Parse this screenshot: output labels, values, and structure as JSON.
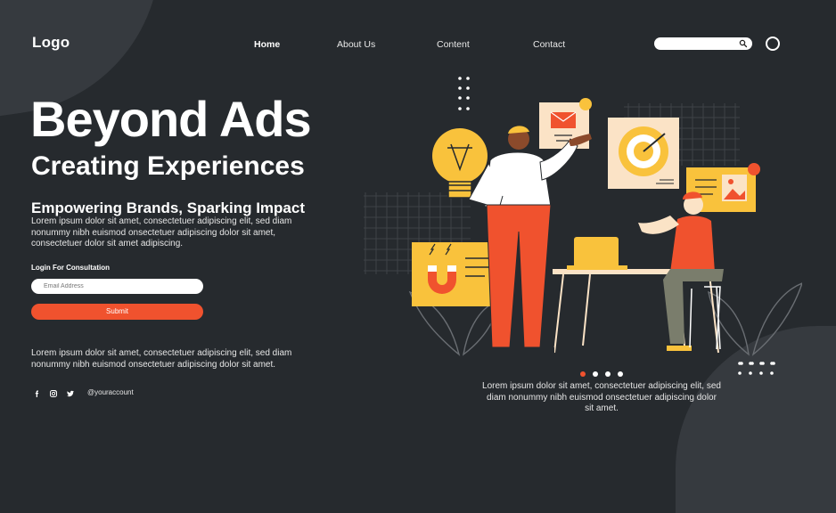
{
  "header": {
    "logo": "Logo",
    "nav": [
      {
        "label": "Home",
        "active": true
      },
      {
        "label": "About Us",
        "active": false
      },
      {
        "label": "Content",
        "active": false
      },
      {
        "label": "Contact",
        "active": false
      }
    ],
    "search_icon": "search-icon"
  },
  "hero": {
    "title": "Beyond Ads",
    "subtitle": "Creating Experiences",
    "tagline": "Empowering Brands, Sparking Impact",
    "description": "Lorem ipsum dolor sit amet, consectetuer adipiscing elit, sed diam nonummy nibh euismod onsectetuer adipiscing dolor sit amet, consectetuer dolor sit amet adipiscing."
  },
  "form": {
    "label": "Login For Consultation",
    "email_placeholder": "Email Address",
    "submit_label": "Submit"
  },
  "footer": {
    "text": "Lorem ipsum dolor sit amet, consectetuer adipiscing elit, sed diam nonummy nibh euismod onsectetuer adipiscing dolor sit amet.",
    "social_icons": [
      "facebook-icon",
      "instagram-icon",
      "twitter-icon"
    ],
    "handle": "@youraccount"
  },
  "carousel": {
    "caption": "Lorem ipsum dolor sit amet, consectetuer adipiscing elit, sed diam nonummy nibh euismod onsectetuer adipiscing dolor sit amet.",
    "slide_count": 4,
    "active_index": 0
  },
  "colors": {
    "background": "#262A2E",
    "accent": "#F0522E",
    "yellow": "#F9C23C",
    "cream": "#FBE3C6"
  }
}
